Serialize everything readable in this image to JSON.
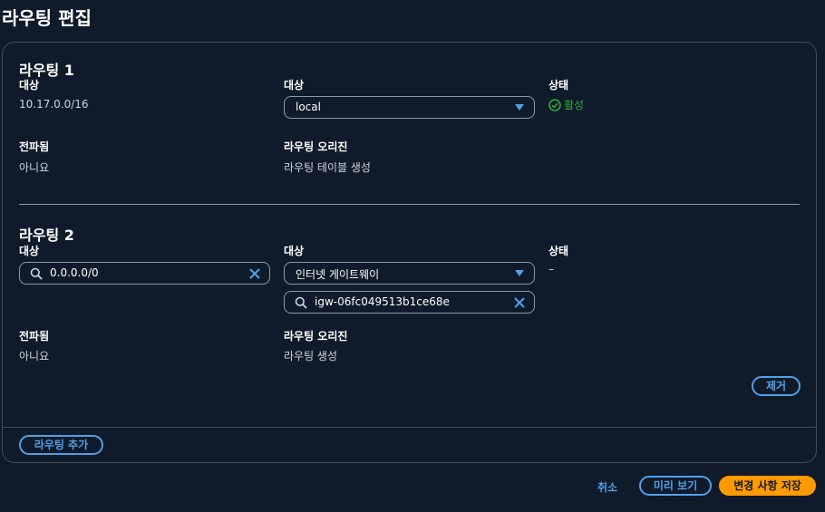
{
  "page": {
    "title": "라우팅 편집"
  },
  "routes": [
    {
      "title": "라우팅 1",
      "destination_label": "대상",
      "destination_value": "10.17.0.0/16",
      "target_label": "대상",
      "target_value": "local",
      "status_label": "상태",
      "status_value": "활성",
      "propagated_label": "전파됨",
      "propagated_value": "아니요",
      "origin_label": "라우팅 오리진",
      "origin_value": "라우팅 테이블 생성"
    },
    {
      "title": "라우팅 2",
      "destination_label": "대상",
      "destination_value": "0.0.0.0/0",
      "target_label": "대상",
      "target_value": "인터넷 게이트웨이",
      "target_id_value": "igw-06fc049513b1ce68e",
      "status_label": "상태",
      "status_value": "–",
      "propagated_label": "전파됨",
      "propagated_value": "아니요",
      "origin_label": "라우팅 오리진",
      "origin_value": "라우팅 생성",
      "remove_label": "제거"
    }
  ],
  "add_route_label": "라우팅 추가",
  "footer": {
    "cancel_label": "취소",
    "preview_label": "미리 보기",
    "save_label": "변경 사항 저장"
  },
  "icons": {
    "status": "check-circle-icon",
    "dropdown": "caret-down-icon",
    "search": "search-icon",
    "clear": "close-icon"
  },
  "colors": {
    "background": "#0f1b2a",
    "accent": "#539fe5",
    "primary": "#ff9900",
    "success": "#29ad32"
  }
}
